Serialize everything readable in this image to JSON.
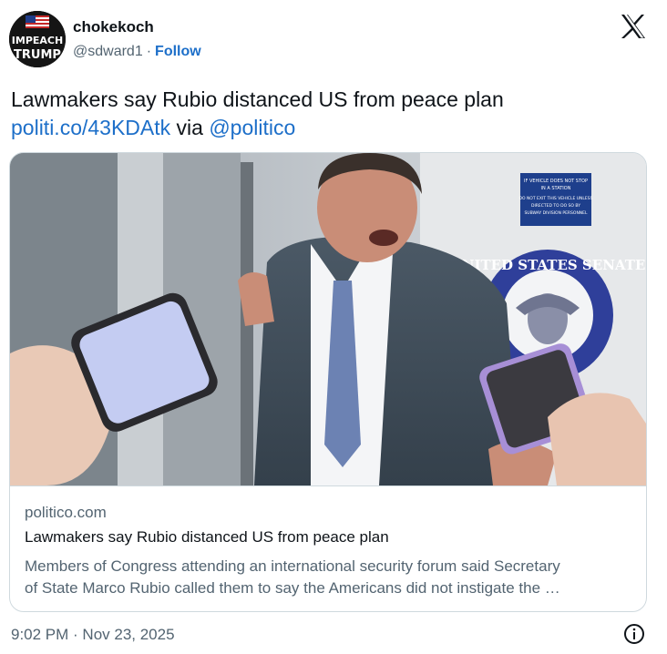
{
  "author": {
    "name": "chokekoch",
    "handle": "@sdward1",
    "separator": "·",
    "follow_label": "Follow",
    "avatar_text": [
      "IMPEACH",
      "TRUMP"
    ]
  },
  "tweet": {
    "text": "Lawmakers say Rubio distanced US from peace plan",
    "link": "politi.co/43KDAtk",
    "via": "via",
    "mention": "@politico"
  },
  "card": {
    "domain": "politico.com",
    "title": "Lawmakers say Rubio distanced US from peace plan",
    "description_line1": "Members of Congress attending an international security forum said Secretary",
    "description_line2": "of State Marco Rubio called them to say the Americans did not instigate the …",
    "image_sign_text": [
      "IF VEHICLE DOES NOT STOP",
      "IN A STATION",
      "DO NOT EXIT THIS VEHICLE UNLESS",
      "DIRECTED TO DO SO BY",
      "SUBWAY DIVISION PERSONNEL"
    ],
    "image_seal_text": "UNITED STATES SENATE"
  },
  "footer": {
    "timestamp": "9:02 PM · Nov 23, 2025"
  },
  "icons": {
    "brand": "x-logo-icon",
    "info": "info-icon"
  },
  "colors": {
    "link": "#1d6fc9",
    "text": "#0f1419",
    "muted": "#536471",
    "border": "#cfd9de"
  }
}
